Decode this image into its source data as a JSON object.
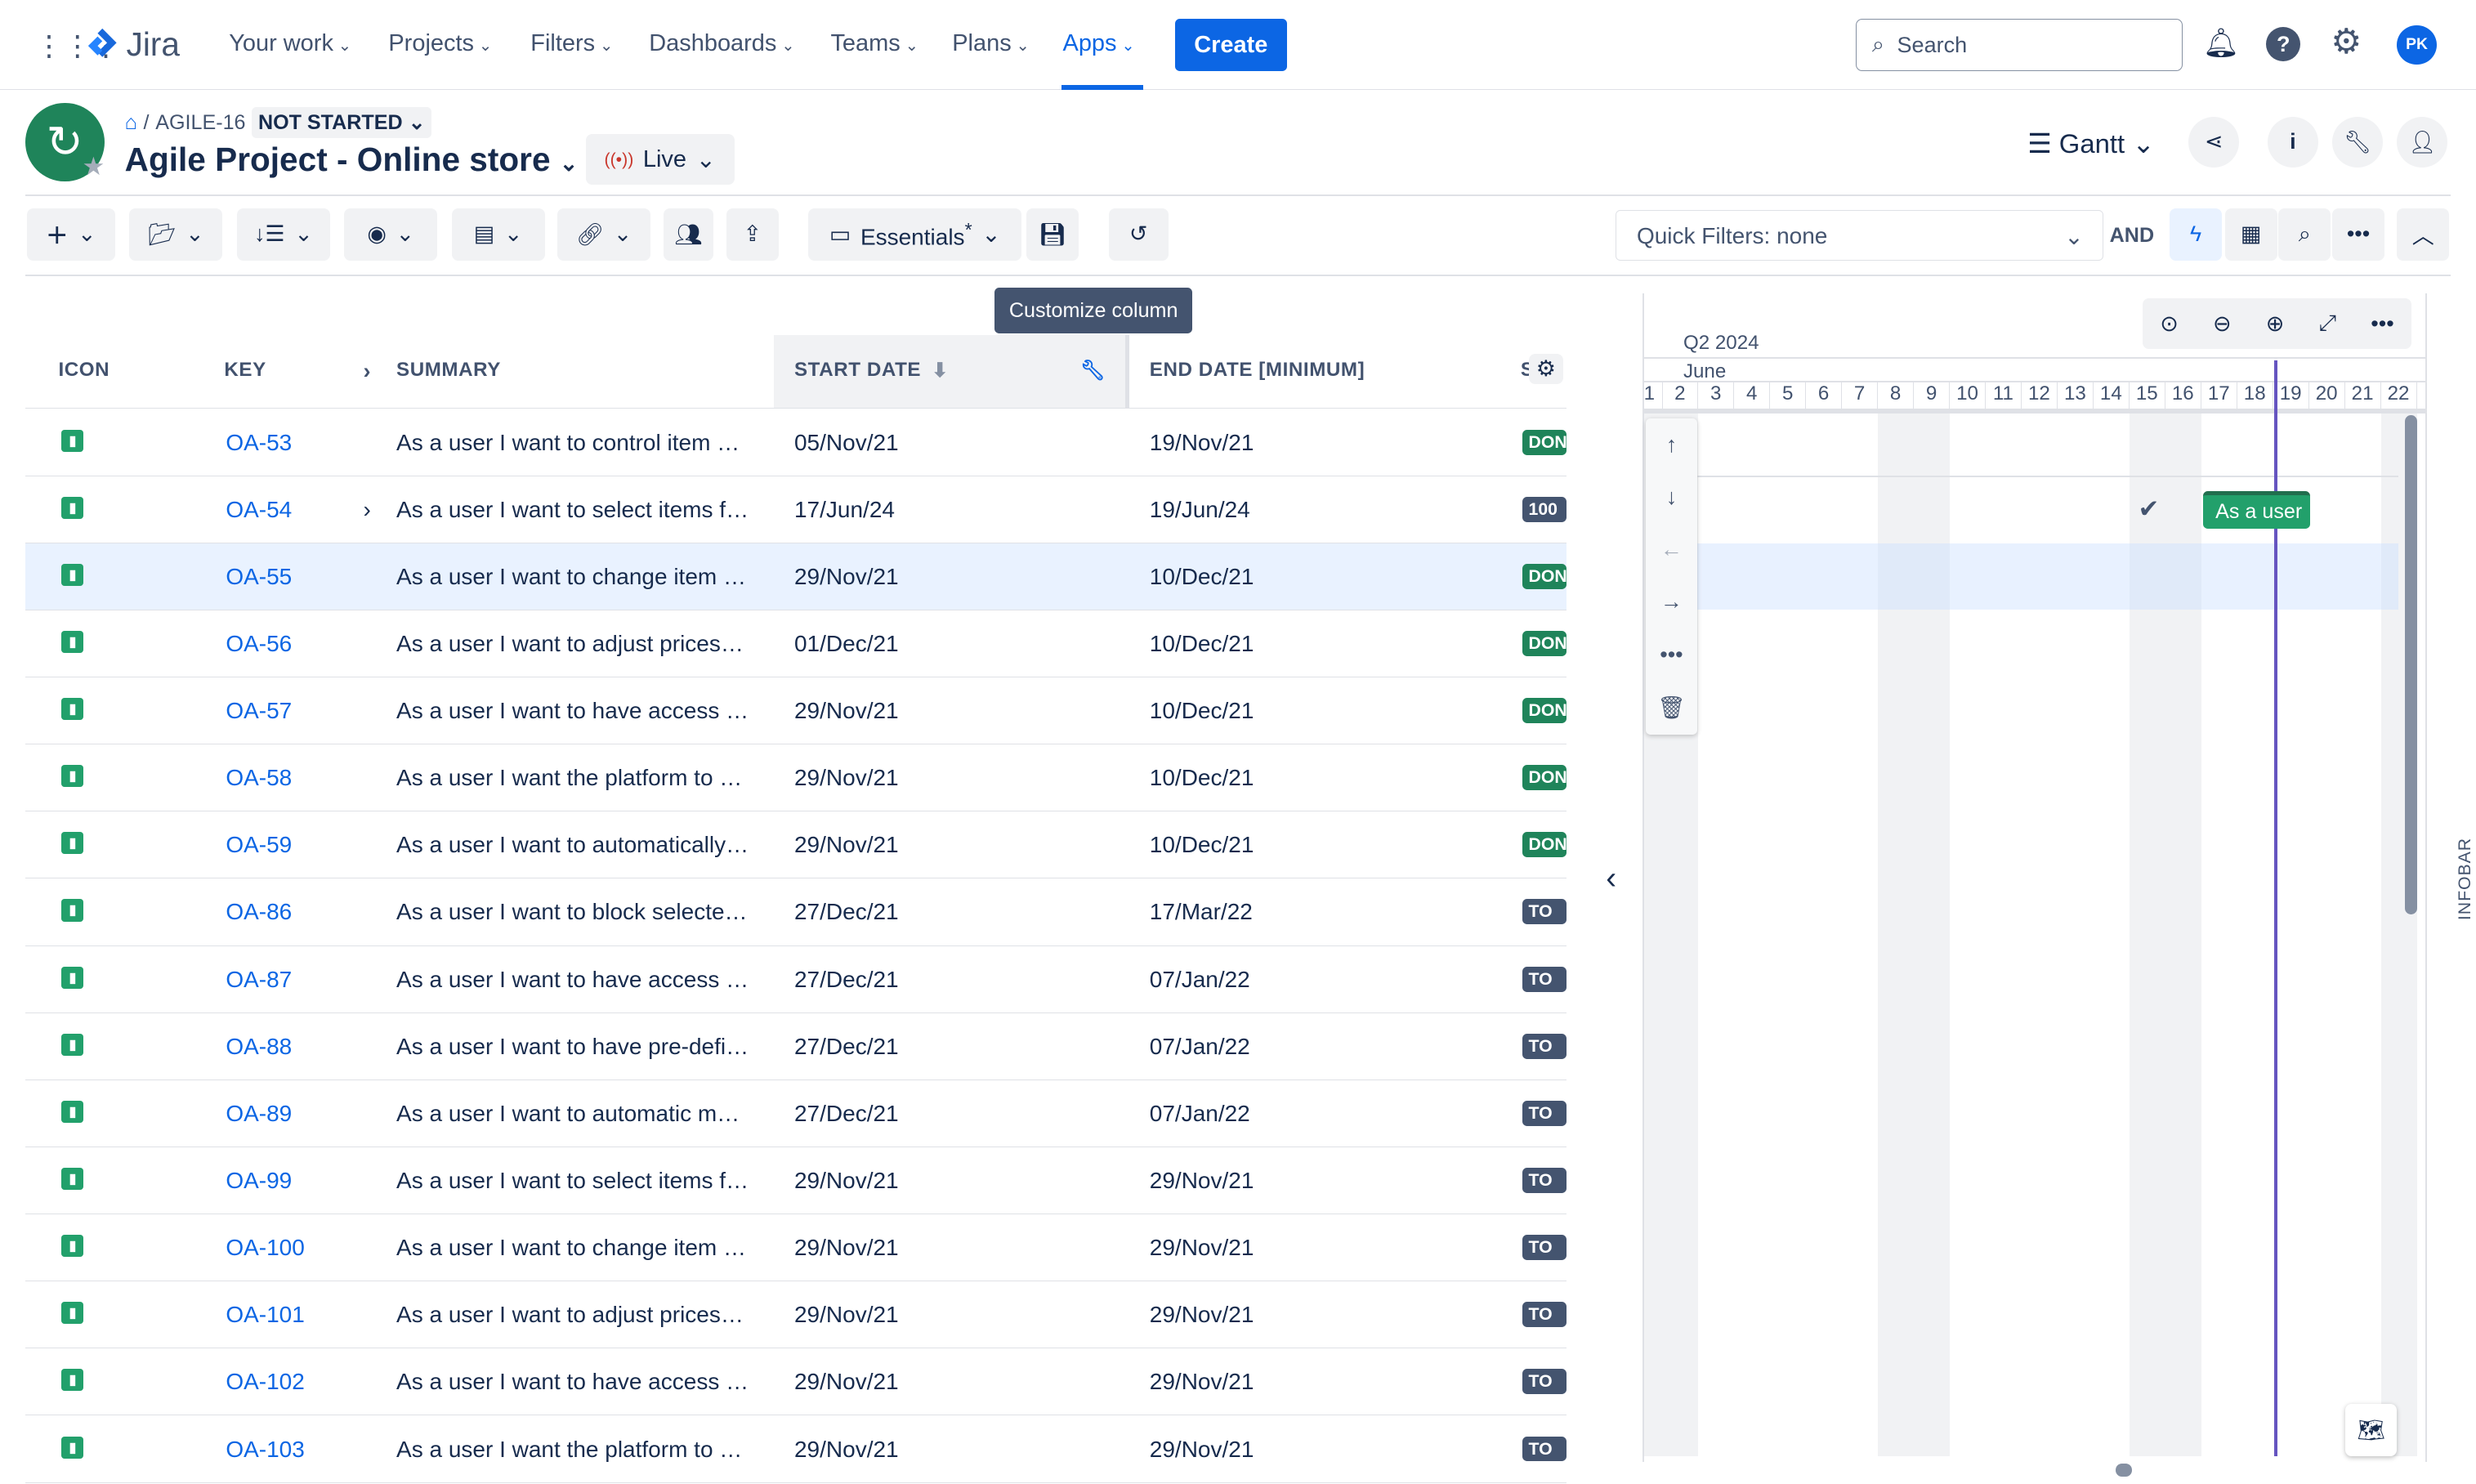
{
  "nav": {
    "logo": "Jira",
    "items": [
      "Your work",
      "Projects",
      "Filters",
      "Dashboards",
      "Teams",
      "Plans",
      "Apps"
    ],
    "active": "Apps",
    "create": "Create",
    "search_placeholder": "Search",
    "avatar": "PK"
  },
  "header": {
    "breadcrumb_key": "AGILE-16",
    "status": "NOT STARTED",
    "title": "Agile Project - Online store",
    "live": "Live",
    "view": "Gantt"
  },
  "toolbar": {
    "view_preset": "Essentials",
    "view_preset_mark": "*",
    "quick_filters": "Quick Filters: none",
    "and": "AND",
    "tooltip": "Customize column"
  },
  "columns": {
    "icon": "ICON",
    "key": "KEY",
    "summary": "SUMMARY",
    "start": "START DATE",
    "end": "END DATE [MINIMUM]",
    "status": "S"
  },
  "rows": [
    {
      "key": "OA-53",
      "summary": "As a user I want to control item …",
      "start": "05/Nov/21",
      "end": "19/Nov/21",
      "status": "DONE",
      "color": "#1f845a"
    },
    {
      "key": "OA-54",
      "summary": "As a user I want to select items f…",
      "start": "17/Jun/24",
      "end": "19/Jun/24",
      "status": "100",
      "color": "#44546f",
      "expand": true
    },
    {
      "key": "OA-55",
      "summary": "As a user I want to change item …",
      "start": "29/Nov/21",
      "end": "10/Dec/21",
      "status": "DONE",
      "color": "#1f845a",
      "selected": true
    },
    {
      "key": "OA-56",
      "summary": "As a user I want to adjust prices…",
      "start": "01/Dec/21",
      "end": "10/Dec/21",
      "status": "DONE",
      "color": "#1f845a"
    },
    {
      "key": "OA-57",
      "summary": "As a user I want to have access …",
      "start": "29/Nov/21",
      "end": "10/Dec/21",
      "status": "DONE",
      "color": "#1f845a"
    },
    {
      "key": "OA-58",
      "summary": "As a user I want the platform to …",
      "start": "29/Nov/21",
      "end": "10/Dec/21",
      "status": "DONE",
      "color": "#1f845a"
    },
    {
      "key": "OA-59",
      "summary": "As a user I want to automatically…",
      "start": "29/Nov/21",
      "end": "10/Dec/21",
      "status": "DONE",
      "color": "#1f845a"
    },
    {
      "key": "OA-86",
      "summary": "As a user I want to block selecte…",
      "start": "27/Dec/21",
      "end": "17/Mar/22",
      "status": "TO DO",
      "color": "#44546f"
    },
    {
      "key": "OA-87",
      "summary": "As a user I want to have access …",
      "start": "27/Dec/21",
      "end": "07/Jan/22",
      "status": "TO DO",
      "color": "#44546f"
    },
    {
      "key": "OA-88",
      "summary": "As a user I want to have pre-defi…",
      "start": "27/Dec/21",
      "end": "07/Jan/22",
      "status": "TO DO",
      "color": "#44546f"
    },
    {
      "key": "OA-89",
      "summary": "As a user I want to automatic m…",
      "start": "27/Dec/21",
      "end": "07/Jan/22",
      "status": "TO DO",
      "color": "#44546f"
    },
    {
      "key": "OA-99",
      "summary": "As a user I want to select items f…",
      "start": "29/Nov/21",
      "end": "29/Nov/21",
      "status": "TO DO",
      "color": "#44546f"
    },
    {
      "key": "OA-100",
      "summary": "As a user I want to change item …",
      "start": "29/Nov/21",
      "end": "29/Nov/21",
      "status": "TO DO",
      "color": "#44546f"
    },
    {
      "key": "OA-101",
      "summary": "As a user I want to adjust prices…",
      "start": "29/Nov/21",
      "end": "29/Nov/21",
      "status": "TO DO",
      "color": "#44546f"
    },
    {
      "key": "OA-102",
      "summary": "As a user I want to have access …",
      "start": "29/Nov/21",
      "end": "29/Nov/21",
      "status": "TO DO",
      "color": "#44546f"
    },
    {
      "key": "OA-103",
      "summary": "As a user I want the platform to …",
      "start": "29/Nov/21",
      "end": "29/Nov/21",
      "status": "TO DO",
      "color": "#44546f"
    }
  ],
  "gantt": {
    "quarter": "Q2 2024",
    "month": "June",
    "days": [
      "1",
      "2",
      "3",
      "4",
      "5",
      "6",
      "7",
      "8",
      "9",
      "10",
      "11",
      "12",
      "13",
      "14",
      "15",
      "16",
      "17",
      "18",
      "19",
      "20",
      "21",
      "22"
    ],
    "bar_label": "As a user",
    "today_day": 18.5,
    "infobar": "INFOBAR"
  },
  "colors": {
    "accent": "#0c66e4",
    "done": "#1f845a",
    "todo": "#44546f",
    "today": "#6554c0",
    "story": "#22a06b"
  }
}
